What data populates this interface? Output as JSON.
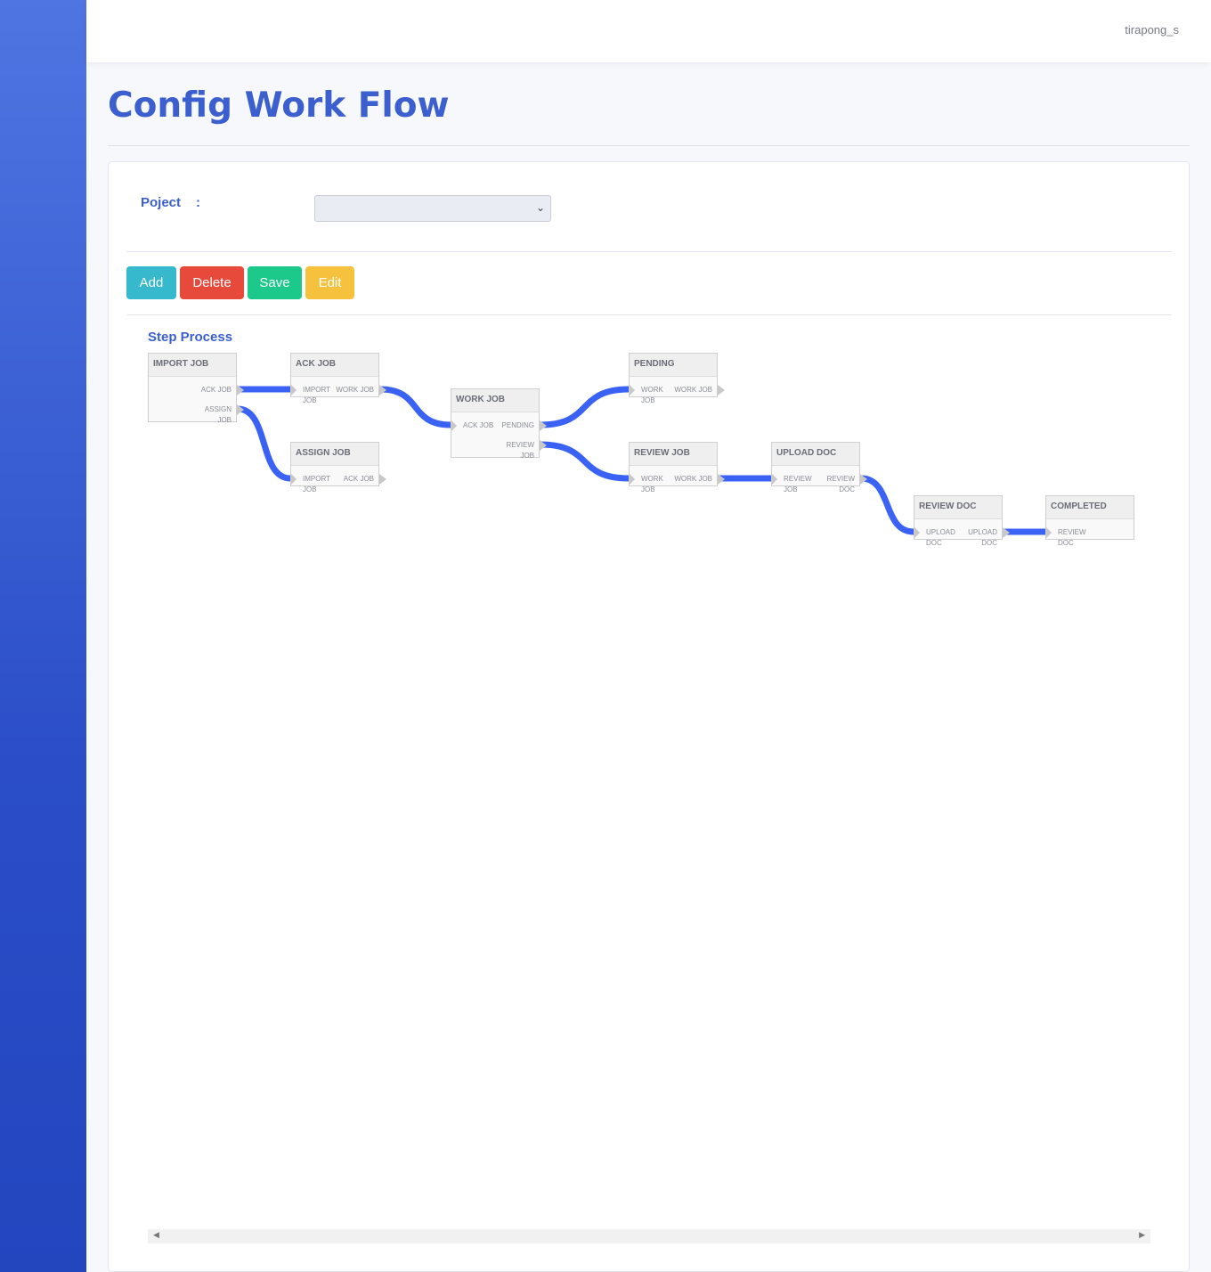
{
  "header": {
    "user": "tirapong_s"
  },
  "page": {
    "title": "Config Work Flow"
  },
  "form": {
    "project_label": "Poject",
    "project_colon": ":",
    "project_value": ""
  },
  "buttons": {
    "add": "Add",
    "delete": "Delete",
    "save": "Save",
    "edit": "Edit"
  },
  "colors": {
    "accent": "#3c5fd0",
    "link": "#3a63f5",
    "add": "#36b9cc",
    "delete": "#e74a3b",
    "save": "#1cc88a",
    "edit": "#f6c23e"
  },
  "flow": {
    "title": "Step Process",
    "nodes": [
      {
        "id": "import_job",
        "title": "IMPORT JOB",
        "inputs": [],
        "outputs": [
          "ACK JOB",
          "ASSIGN JOB"
        ]
      },
      {
        "id": "ack_job",
        "title": "ACK JOB",
        "inputs": [
          "IMPORT JOB"
        ],
        "outputs": [
          "WORK JOB"
        ]
      },
      {
        "id": "assign_job",
        "title": "ASSIGN JOB",
        "inputs": [
          "IMPORT JOB"
        ],
        "outputs": [
          "ACK JOB"
        ]
      },
      {
        "id": "work_job",
        "title": "WORK JOB",
        "inputs": [
          "ACK JOB"
        ],
        "outputs": [
          "PENDING",
          "REVIEW JOB"
        ]
      },
      {
        "id": "pending",
        "title": "PENDING",
        "inputs": [
          "WORK JOB"
        ],
        "outputs": [
          "WORK JOB"
        ]
      },
      {
        "id": "review_job",
        "title": "REVIEW JOB",
        "inputs": [
          "WORK JOB"
        ],
        "outputs": [
          "WORK JOB"
        ]
      },
      {
        "id": "upload_doc",
        "title": "UPLOAD DOC",
        "inputs": [
          "REVIEW JOB"
        ],
        "outputs": [
          "REVIEW DOC"
        ]
      },
      {
        "id": "review_doc",
        "title": "REVIEW DOC",
        "inputs": [
          "UPLOAD DOC"
        ],
        "outputs": [
          "UPLOAD DOC"
        ]
      },
      {
        "id": "completed",
        "title": "COMPLETED",
        "inputs": [
          "REVIEW DOC"
        ],
        "outputs": []
      }
    ],
    "links": [
      [
        "import_job",
        0,
        "ack_job",
        0
      ],
      [
        "import_job",
        1,
        "assign_job",
        0
      ],
      [
        "ack_job",
        0,
        "work_job",
        0
      ],
      [
        "work_job",
        0,
        "pending",
        0
      ],
      [
        "work_job",
        1,
        "review_job",
        0
      ],
      [
        "review_job",
        0,
        "upload_doc",
        0
      ],
      [
        "upload_doc",
        0,
        "review_doc",
        0
      ],
      [
        "review_doc",
        0,
        "completed",
        0
      ]
    ]
  }
}
